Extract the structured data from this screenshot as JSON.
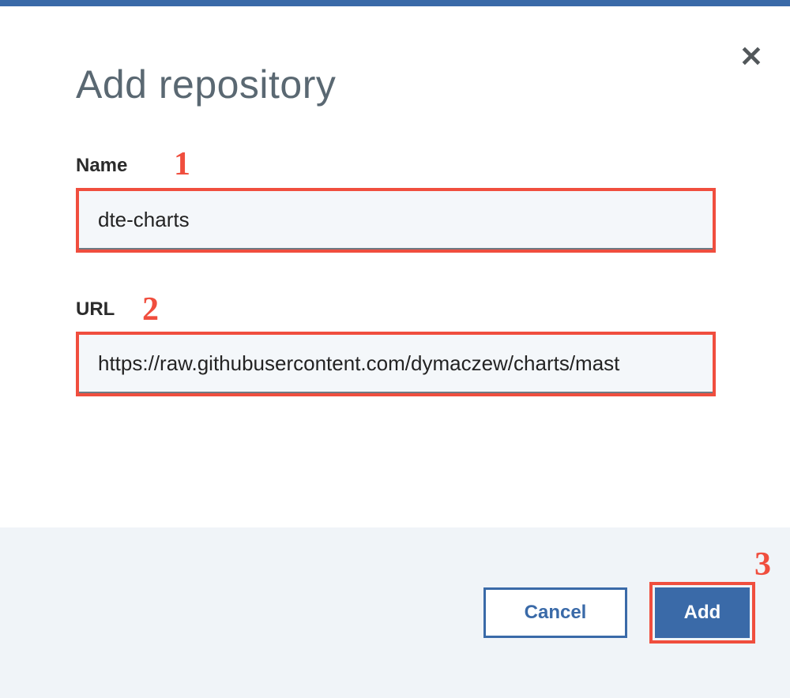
{
  "modal": {
    "title": "Add repository",
    "close_symbol": "✕",
    "fields": {
      "name": {
        "label": "Name",
        "value": "dte-charts",
        "annotation": "1"
      },
      "url": {
        "label": "URL",
        "value": "https://raw.githubusercontent.com/dymaczew/charts/mast",
        "annotation": "2"
      }
    },
    "footer": {
      "cancel_label": "Cancel",
      "add_label": "Add",
      "add_annotation": "3"
    }
  }
}
